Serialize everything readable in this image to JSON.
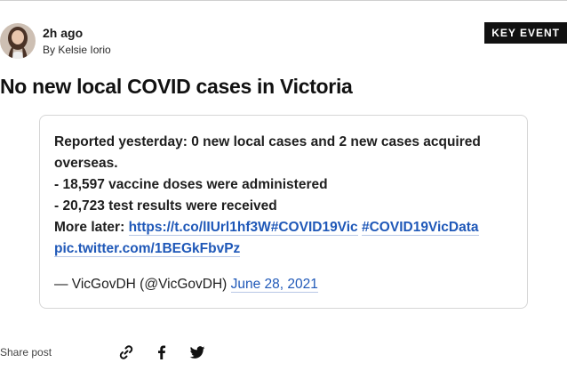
{
  "post": {
    "time": "2h ago",
    "byline": "By Kelsie Iorio",
    "badge": "KEY EVENT",
    "headline": "No new local COVID cases in Victoria"
  },
  "tweet": {
    "line1": "Reported yesterday: 0 new local cases and 2 new cases acquired overseas.",
    "line2": "- 18,597 vaccine doses were administered",
    "line3": "- 20,723 test results were received",
    "more_prefix": "More later: ",
    "link_url": "https://t.co/lIUrl1hf3W",
    "hashtag1": "#COVID19Vic",
    "hashtag2": "#COVID19VicData",
    "pic_link": "pic.twitter.com/1BEGkFbvPz",
    "attribution": "— VicGovDH (@VicGovDH) ",
    "date": "June 28, 2021"
  },
  "share": {
    "label": "Share post",
    "icons": [
      "link-icon",
      "facebook-icon",
      "twitter-icon"
    ]
  }
}
